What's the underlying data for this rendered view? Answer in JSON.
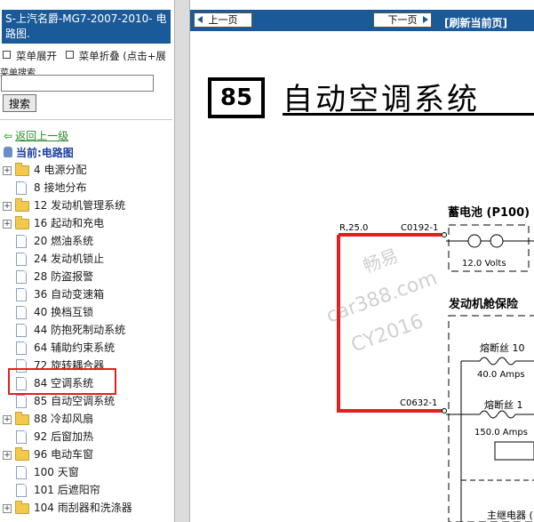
{
  "left": {
    "title": "S-上汽名爵-MG7-2007-2010- 电路图.",
    "menu_expand": "菜单展开",
    "menu_collapse": "菜单折叠 (点击+展",
    "search_label": "菜单搜索",
    "search_value": "",
    "search_button": "搜索",
    "back_link": "返回上一级",
    "current": "当前:电路图",
    "tree": [
      {
        "label": "4 电源分配",
        "type": "folder"
      },
      {
        "label": "8 接地分布",
        "type": "doc"
      },
      {
        "label": "12 发动机管理系统",
        "type": "folder"
      },
      {
        "label": "16 起动和充电",
        "type": "folder"
      },
      {
        "label": "20 燃油系统",
        "type": "doc"
      },
      {
        "label": "24 发动机锁止",
        "type": "doc"
      },
      {
        "label": "28 防盗报警",
        "type": "doc"
      },
      {
        "label": "36 自动变速箱",
        "type": "doc"
      },
      {
        "label": "40 换档互锁",
        "type": "doc"
      },
      {
        "label": "44 防抱死制动系统",
        "type": "doc"
      },
      {
        "label": "64 辅助约束系统",
        "type": "doc"
      },
      {
        "label": "72 旋转耦合器",
        "type": "doc"
      },
      {
        "label": "84 空调系统",
        "type": "doc",
        "selected": true
      },
      {
        "label": "85 自动空调系统",
        "type": "doc"
      },
      {
        "label": "88 冷却风扇",
        "type": "folder"
      },
      {
        "label": "92 后窗加热",
        "type": "doc"
      },
      {
        "label": "96 电动车窗",
        "type": "folder"
      },
      {
        "label": "100 天窗",
        "type": "doc"
      },
      {
        "label": "101 后遮阳帘",
        "type": "doc"
      },
      {
        "label": "104 雨刮器和洗涤器",
        "type": "folder"
      }
    ]
  },
  "nav": {
    "prev": "上一页",
    "next": "下一页",
    "refresh": "[刷新当前页]"
  },
  "diagram": {
    "page_number": "85",
    "title": "自动空调系统",
    "wire_label": "R,25.0",
    "connector_1": "C0192-1",
    "battery_label": "蓄电池 (P100)",
    "battery_volts": "12.0 Volts",
    "fusebox_label": "发动机舱保险",
    "fuse_10_label": "熔断丝 10",
    "fuse_10_amps": "40.0 Amps",
    "connector_2": "C0632-1",
    "fuse_1_label": "熔断丝 1",
    "fuse_1_amps": "150.0 Amps",
    "main_relay": "主继电器 (",
    "colors": {
      "wire_highlight": "#e02020",
      "nav": "#1b5a99"
    }
  },
  "watermark": {
    "line1": "畅易",
    "line2": "car388.com",
    "line3": "CY2016"
  }
}
